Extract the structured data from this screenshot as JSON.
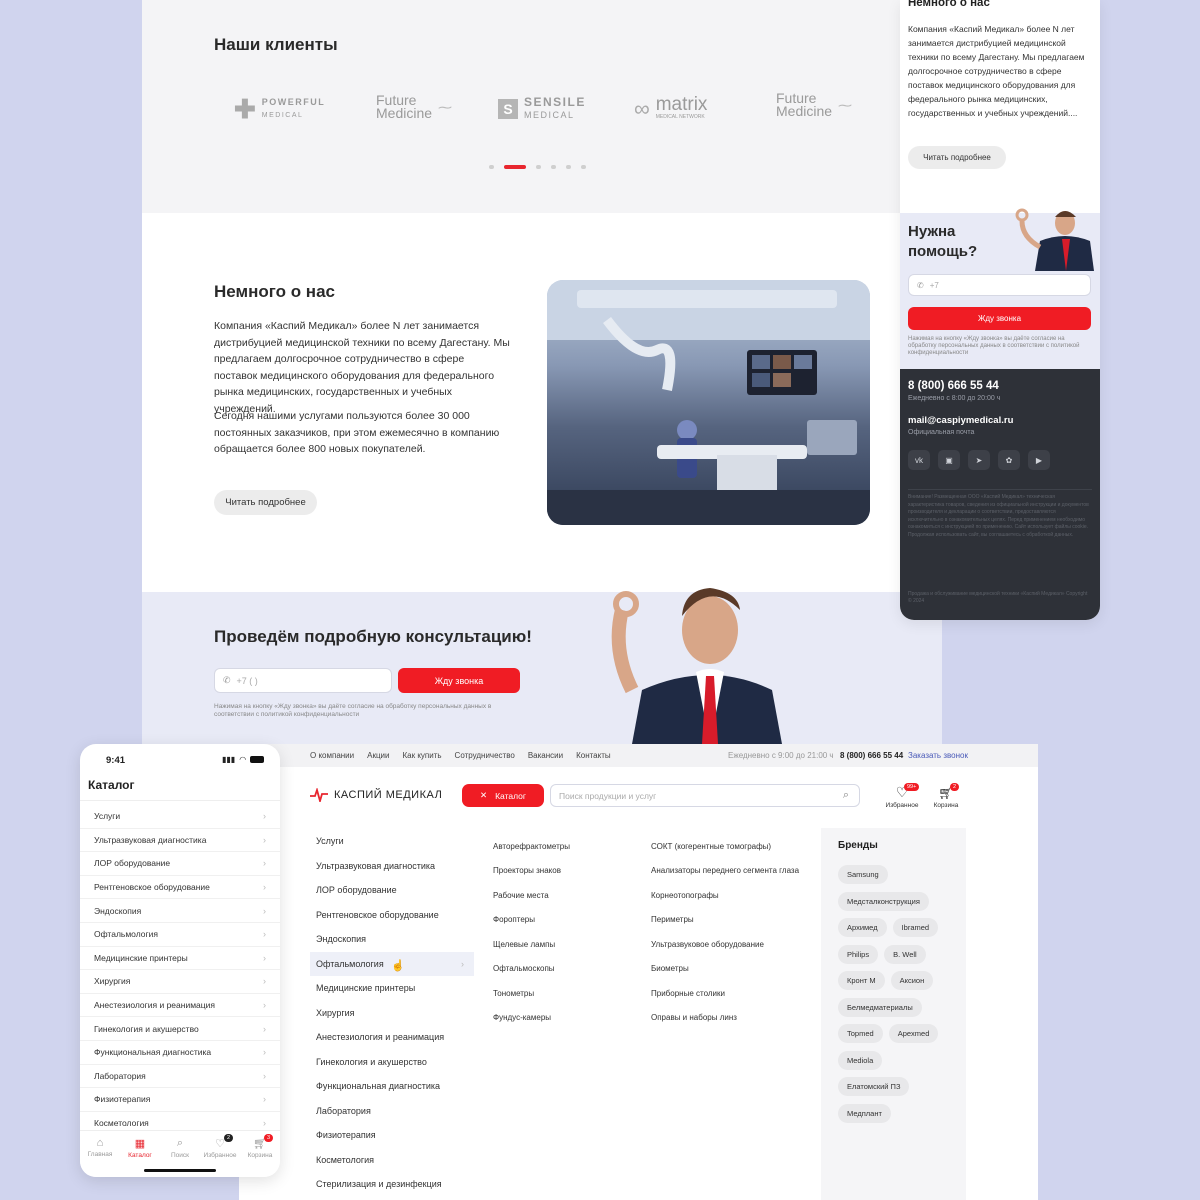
{
  "colors": {
    "accent": "#f01c24",
    "dark_footer": "#2e3138",
    "page_bg": "#d0d4ee"
  },
  "clients": {
    "title": "Наши клиенты",
    "logos": [
      {
        "line1": "POWERFUL",
        "line2": "MEDICAL",
        "icon": "plus-icon"
      },
      {
        "line1": "Future",
        "line2": "Medicine",
        "icon": "dna-icon"
      },
      {
        "line1": "SENSILE",
        "line2": "MEDICAL",
        "icon": "s-icon"
      },
      {
        "line1": "matrix",
        "line2": "MEDICAL NETWORK",
        "icon": "infinity-icon"
      },
      {
        "line1": "Future",
        "line2": "Medicine",
        "icon": "dna-icon"
      }
    ]
  },
  "about": {
    "title": "Немного о нас",
    "p1": "Компания «Каспий Медикал» более N лет занимается дистрибуцией медицинской техники по всему Дагестану. Мы предлагаем долгосрочное сотрудничество в сфере поставок медицинского оборудования для федерального рынка медицинских, государственных и учебных учреждений.",
    "p2": "Сегодня нашими услугами пользуются более 30 000 постоянных заказчиков, при этом ежемесячно в компанию обращается более 800 новых покупателей.",
    "button": "Читать подробнее"
  },
  "consult": {
    "title": "Проведём подробную консультацию!",
    "phone_placeholder": "+7 (    )",
    "button": "Жду звонка",
    "note": "Нажимая на кнопку «Жду звонка» вы даёте согласие на обработку персональных данных в соответствии с политикой конфиденциальности"
  },
  "mobile_right": {
    "about_title": "Немного о нас",
    "about_text": "Компания «Каспий Медикал» более N лет занимается дистрибуцией медицинской техники по всему Дагестану. Мы предлагаем долгосрочное сотрудничество в сфере поставок медицинского оборудования для федерального рынка медицинских, государственных и учебных учреждений....",
    "about_button": "Читать подробнее",
    "help_title": "Нужна помощь?",
    "phone_placeholder": "+7",
    "help_button": "Жду звонка",
    "help_note": "Нажимая на кнопку «Жду звонка» вы даёте согласие на обработку персональных данных в соответствии с политикой конфиденциальности",
    "phone": "8 (800) 666 55 44",
    "hours": "Ежедневно с 8:00 до 20:00 ч",
    "email": "mail@caspiymedical.ru",
    "email_label": "Официальная почта",
    "socials": [
      "vk-icon",
      "ok-icon",
      "telegram-icon",
      "odnoklassniki-icon",
      "youtube-icon"
    ],
    "legal": "Внимание! Размещенная ООО «Каспий Медикал» техническая характеристика товаров, сведения из официальной инструкции и документов производителя и декларации о соответствии, предоставляются исключительно в ознакомительных целях. Перед применением необходимо ознакомиться с инструкцией по применению. Сайт использует файлы cookie. Продолжая использовать сайт, вы соглашаетесь с обработкой данных.",
    "copyright": "Продажа и обслуживание медицинской техники «Каспий Медикал» Copyright © 2024"
  },
  "mobile_left": {
    "time": "9:41",
    "title": "Каталог",
    "items": [
      "Услуги",
      "Ультразвуковая диагностика",
      "ЛОР оборудование",
      "Рентгеновское оборудование",
      "Эндоскопия",
      "Офтальмология",
      "Медицинские принтеры",
      "Хирургия",
      "Анестезиология и реанимация",
      "Гинекология и акушерство",
      "Функциональная диагностика",
      "Лаборатория",
      "Физиотерапия",
      "Косметология"
    ],
    "tabs": [
      {
        "label": "Главная",
        "icon": "home-icon"
      },
      {
        "label": "Каталог",
        "icon": "grid-icon"
      },
      {
        "label": "Поиск",
        "icon": "search-icon"
      },
      {
        "label": "Избранное",
        "icon": "heart-icon",
        "badge": "2"
      },
      {
        "label": "Корзина",
        "icon": "cart-icon",
        "badge": "3"
      }
    ]
  },
  "desktop": {
    "nav": [
      "О компании",
      "Акции",
      "Как купить",
      "Сотрудничество",
      "Вакансии",
      "Контакты"
    ],
    "hours": "Ежедневно с 9:00 до 21:00 ч",
    "phone": "8 (800) 666 55 44",
    "callback": "Заказать звонок",
    "brand": "КАСПИЙ МЕДИКАЛ",
    "catalog_button": "Каталог",
    "search_placeholder": "Поиск продукции и услуг",
    "favorites_label": "Избранное",
    "favorites_badge": "99+",
    "cart_label": "Корзина",
    "cart_badge": "2",
    "categories": [
      "Услуги",
      "Ультразвуковая диагностика",
      "ЛОР оборудование",
      "Рентгеновское оборудование",
      "Эндоскопия",
      "Офтальмология",
      "Медицинские принтеры",
      "Хирургия",
      "Анестезиология и реанимация",
      "Гинекология и акушерство",
      "Функциональная диагностика",
      "Лаборатория",
      "Физиотерапия",
      "Косметология",
      "Стерилизация и дезинфекция"
    ],
    "selected_category": "Офтальмология",
    "sub1": [
      "Авторефрактометры",
      "Проекторы знаков",
      "Рабочие места",
      "Фороптеры",
      "Щелевые лампы",
      "Офтальмоскопы",
      "Тонометры",
      "Фундус-камеры"
    ],
    "sub2": [
      "СОКТ (когерентные томографы)",
      "Анализаторы переднего сегмента глаза",
      "Корнеотопографы",
      "Периметры",
      "Ультразвуковое оборудование",
      "Биометры",
      "Приборные столики",
      "Оправы и наборы линз"
    ],
    "brands_title": "Бренды",
    "brands": [
      [
        "Samsung"
      ],
      [
        "Медсталконструкция"
      ],
      [
        "Архимед",
        "Ibramed"
      ],
      [
        "Philips",
        "B. Well"
      ],
      [
        "Кронт М",
        "Аксион"
      ],
      [
        "Белмедматериалы"
      ],
      [
        "Topmed",
        "Apexmed"
      ],
      [
        "Mediola"
      ],
      [
        "Елатомский ПЗ"
      ],
      [
        "Медплант"
      ]
    ]
  }
}
